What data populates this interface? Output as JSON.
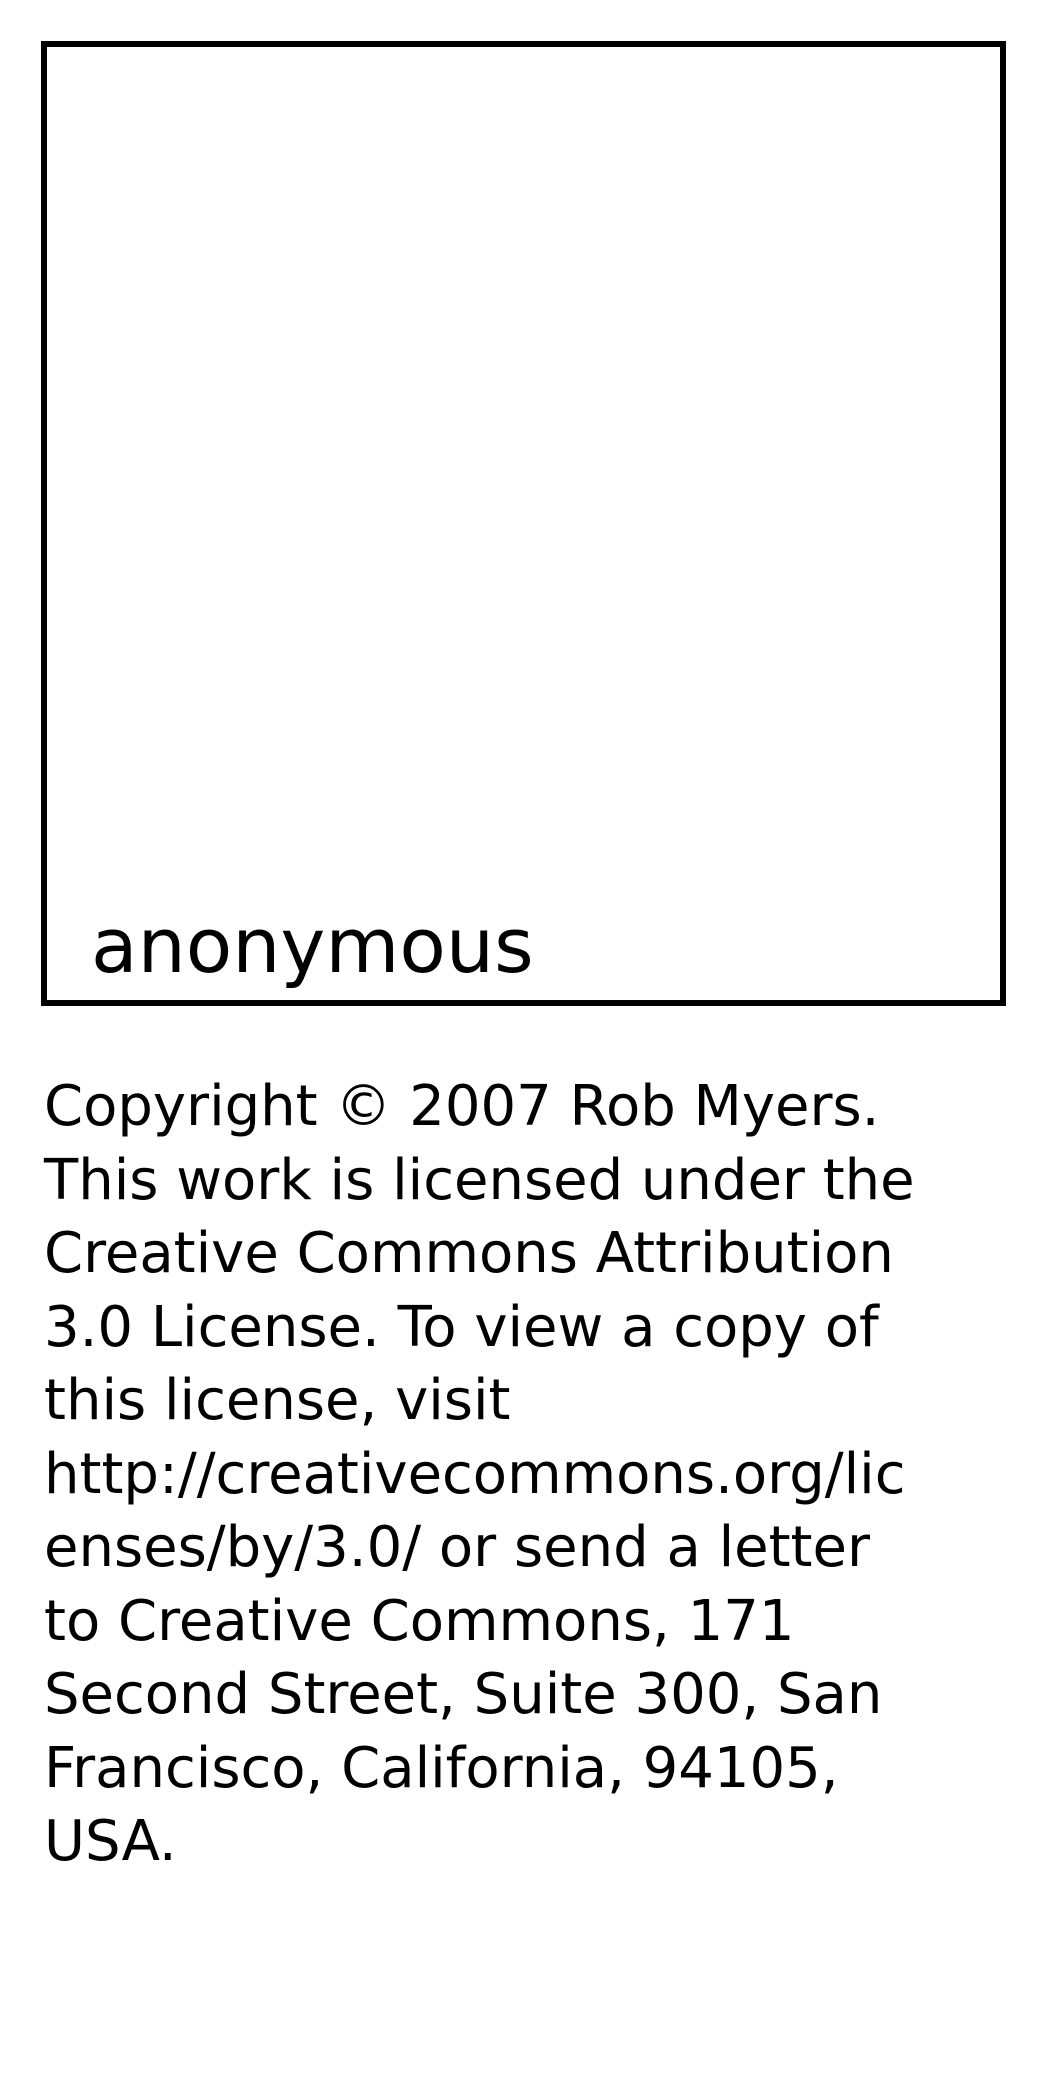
{
  "card": {
    "name": "anonymous"
  },
  "license": {
    "lines": [
      "Copyright © 2007 Rob Myers.",
      "This work is licensed under the",
      "Creative Commons Attribution",
      "3.0 License. To view a copy of",
      "this license, visit",
      "http://creativecommons.org/lic",
      "enses/by/3.0/ or send a letter",
      "to Creative Commons, 171",
      "Second Street, Suite 300, San",
      "Francisco, California, 94105,",
      "USA."
    ]
  }
}
